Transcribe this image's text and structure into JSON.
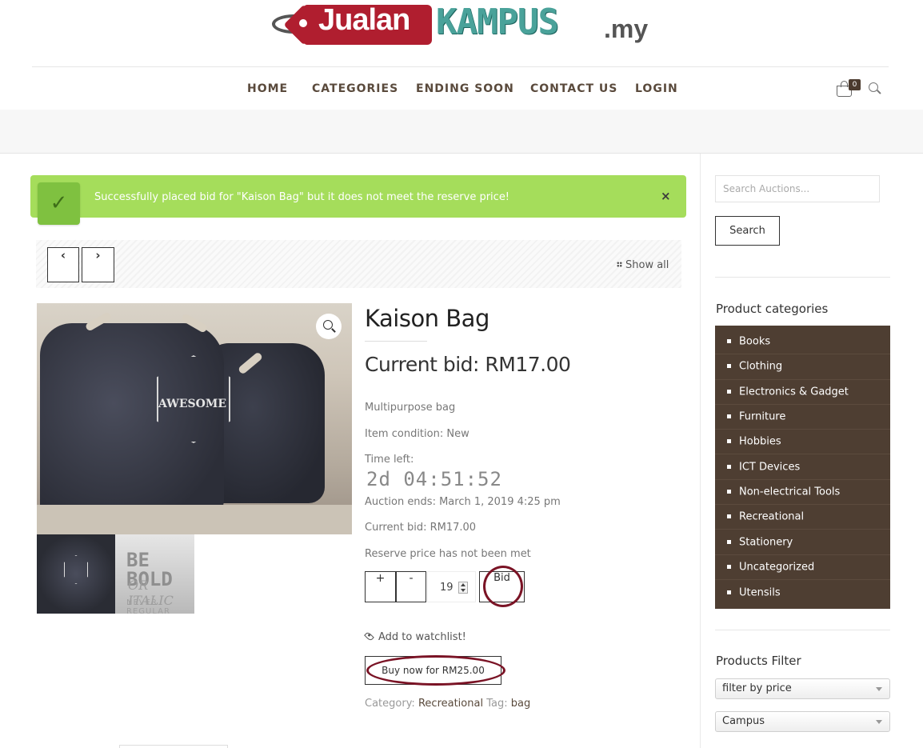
{
  "brand": {
    "part1": "Jualan",
    "part2": "KAMPUS",
    "part3": ".my",
    "tag_color": "#b01e2f",
    "kampus_color": "#4aa29a"
  },
  "nav": {
    "items": [
      "HOME",
      "CATEGORIES",
      "ENDING SOON",
      "CONTACT US",
      "LOGIN"
    ],
    "cart_count": "0"
  },
  "notice": {
    "message": "Successfully placed bid for \"Kaison Bag\" but it does not meet the reserve price!",
    "close": "×",
    "check": "✓",
    "color": "#a5dd5b"
  },
  "product_nav": {
    "prev": "‹",
    "next": "›",
    "show_all": "Show all"
  },
  "gallery": {
    "main_word": "AWESOME",
    "thumb2_line1": "BE BOLD",
    "thumb2_line2": "OR ITALIC",
    "thumb2_line3": "NEVER REGULAR"
  },
  "product": {
    "title": "Kaison Bag",
    "current_bid_heading": "Current bid: RM17.00",
    "description": "Multipurpose bag",
    "condition": "Item condition: New",
    "time_left_label": "Time left:",
    "countdown": "2d 04:51:52",
    "auction_ends": "Auction ends: March 1, 2019 4:25 pm",
    "current_bid": "Current bid: RM17.00",
    "reserve_note": "Reserve price has not been met",
    "plus": "+",
    "minus": "-",
    "quantity": "19",
    "bid_label": "Bid",
    "watchlist": "Add to watchlist!",
    "buy_now": "Buy now for RM25.00",
    "category_label": "Category:",
    "category": "Recreational",
    "tag_label": "Tag:",
    "tag": "bag",
    "annotation_color": "#7a1325"
  },
  "sidebar": {
    "search_placeholder": "Search Auctions...",
    "search_button": "Search",
    "categories_title": "Product categories",
    "categories": [
      "Books",
      "Clothing",
      "Electronics & Gadget",
      "Furniture",
      "Hobbies",
      "ICT Devices",
      "Non-electrical Tools",
      "Recreational",
      "Stationery",
      "Uncategorized",
      "Utensils"
    ],
    "categories_bg": "#4e3e32",
    "filter_title": "Products Filter",
    "filter_price": "filter by price",
    "filter_campus": "Campus"
  }
}
